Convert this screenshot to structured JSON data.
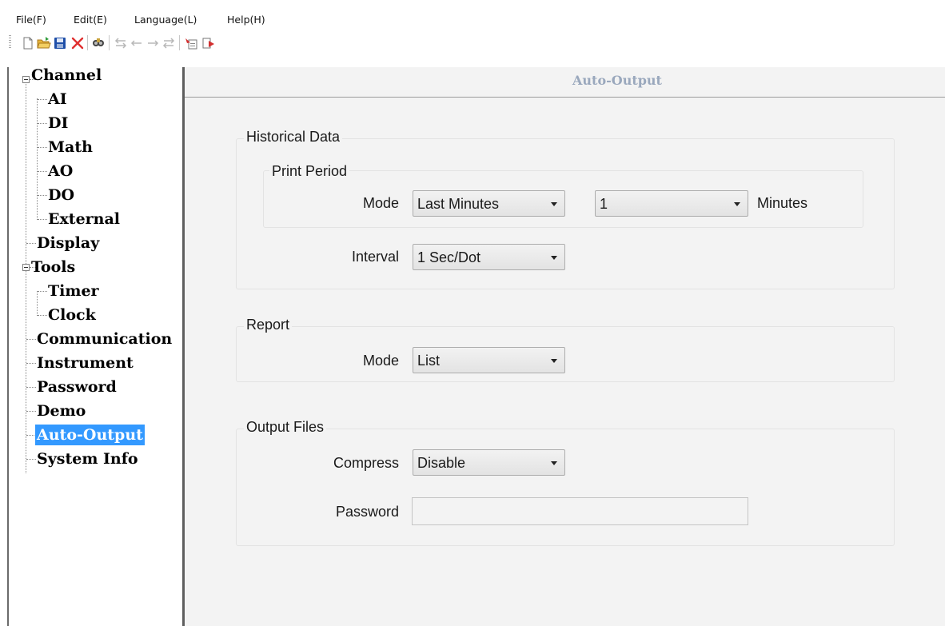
{
  "menu": {
    "items": [
      {
        "label": "File(F)"
      },
      {
        "label": "Edit(E)"
      },
      {
        "label": "Language(L)"
      },
      {
        "label": "Help(H)"
      }
    ]
  },
  "toolbar": {
    "icons": [
      "new-file-icon",
      "open-folder-icon",
      "save-icon",
      "delete-icon",
      "find-icon",
      "move-all-left-icon",
      "move-left-icon",
      "move-right-icon",
      "move-all-right-icon",
      "download-icon",
      "upload-icon"
    ],
    "colors": {
      "accent": "#3399ff",
      "delete": "#e03030",
      "save": "#1f4fa8",
      "folder": "#e7b43a"
    }
  },
  "tree": {
    "items": [
      {
        "label": "Channel"
      },
      {
        "label": "AI"
      },
      {
        "label": "DI"
      },
      {
        "label": "Math"
      },
      {
        "label": "AO"
      },
      {
        "label": "DO"
      },
      {
        "label": "External"
      },
      {
        "label": "Display"
      },
      {
        "label": "Tools"
      },
      {
        "label": "Timer"
      },
      {
        "label": "Clock"
      },
      {
        "label": "Communication"
      },
      {
        "label": "Instrument"
      },
      {
        "label": "Password"
      },
      {
        "label": "Demo"
      },
      {
        "label": "Auto-Output"
      },
      {
        "label": "System Info"
      }
    ],
    "selected": "Auto-Output"
  },
  "panel": {
    "title": "Auto-Output",
    "historical": {
      "title": "Historical Data",
      "print_period": {
        "title": "Print Period",
        "mode_label": "Mode",
        "mode_value": "Last Minutes",
        "count_value": "1",
        "unit_label": "Minutes"
      },
      "interval_label": "Interval",
      "interval_value": "1 Sec/Dot"
    },
    "report": {
      "title": "Report",
      "mode_label": "Mode",
      "mode_value": "List"
    },
    "output_files": {
      "title": "Output Files",
      "compress_label": "Compress",
      "compress_value": "Disable",
      "password_label": "Password",
      "password_value": ""
    }
  }
}
